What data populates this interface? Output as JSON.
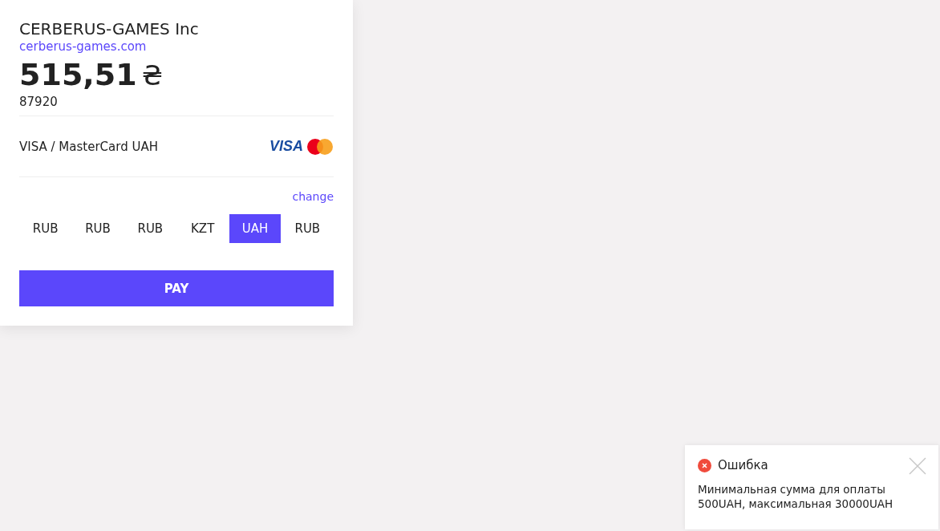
{
  "merchant": {
    "name": "CERBERUS-GAMES Inc",
    "site": "cerberus-games.com"
  },
  "amount": "515,51",
  "currency_sign": "₴",
  "order": "87920",
  "method": {
    "label": "VISA / MasterCard UAH",
    "brand": "VISA"
  },
  "change_link": "change",
  "currencies": [
    {
      "label": "RUB",
      "selected": false
    },
    {
      "label": "RUB",
      "selected": false
    },
    {
      "label": "RUB",
      "selected": false
    },
    {
      "label": "KZT",
      "selected": false
    },
    {
      "label": "UAH",
      "selected": true
    },
    {
      "label": "RUB",
      "selected": false
    }
  ],
  "pay_button": "PAY",
  "toast": {
    "title": "Ошибка",
    "message": "Минимальная сумма для оплаты 500UAH, максимальная 30000UAH"
  }
}
